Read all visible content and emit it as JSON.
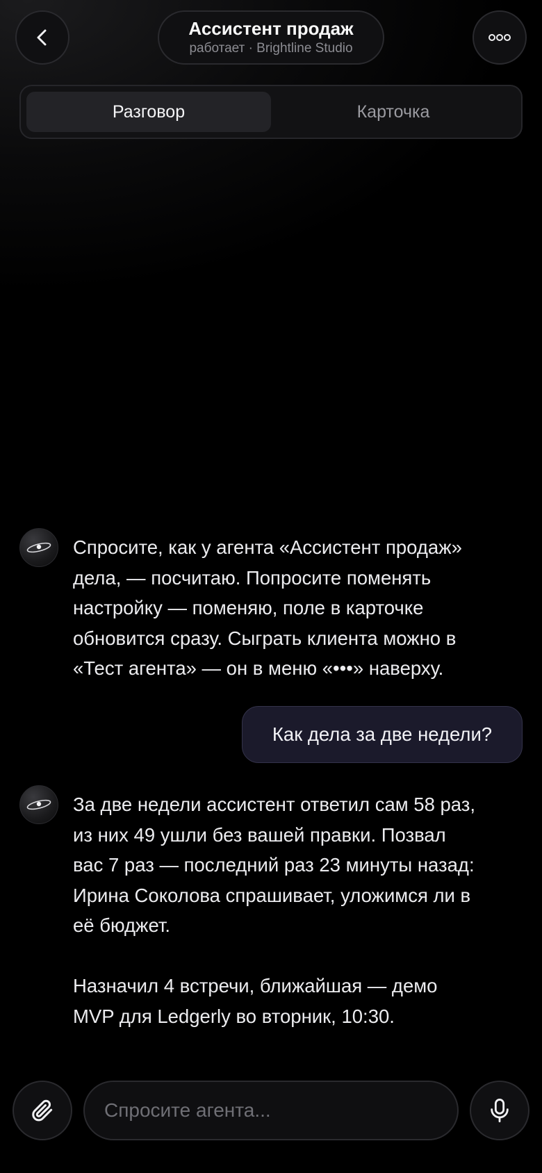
{
  "header": {
    "title": "Ассистент продаж",
    "subtitle": "работает · Brightline Studio",
    "back_icon": "chevron-left-icon",
    "more_icon": "more-dots-icon"
  },
  "tabs": [
    {
      "label": "Разговор",
      "active": true
    },
    {
      "label": "Карточка",
      "active": false
    }
  ],
  "messages": {
    "agent_intro": {
      "avatar_icon": "planet-icon",
      "lines": [
        "Спросите, как у агента «Ассистент продаж»",
        "дела, — посчитаю. Попросите поменять",
        "настройку — поменяю, поле в карточке",
        "обновится сразу. Сыграть клиента можно в",
        "«Тест агента» — он в меню «•••» наверху."
      ]
    },
    "user_question": "Как дела за две недели?",
    "agent_reply": {
      "avatar_icon": "planet-icon",
      "paragraph1": [
        "За две недели ассистент ответил сам 58 раз,",
        "из них 49 ушли без вашей правки. Позвал",
        "вас 7 раз — последний раз 23 минуты назад:",
        "Ирина Соколова спрашивает, уложимся ли в",
        "её бюджет."
      ],
      "paragraph2": [
        "Назначил 4 встречи, ближайшая — демо",
        "MVP для Ledgerly во вторник, 10:30."
      ]
    }
  },
  "composer": {
    "placeholder": "Спросите агента...",
    "value": "",
    "attach_icon": "paperclip-icon",
    "mic_icon": "microphone-icon"
  }
}
